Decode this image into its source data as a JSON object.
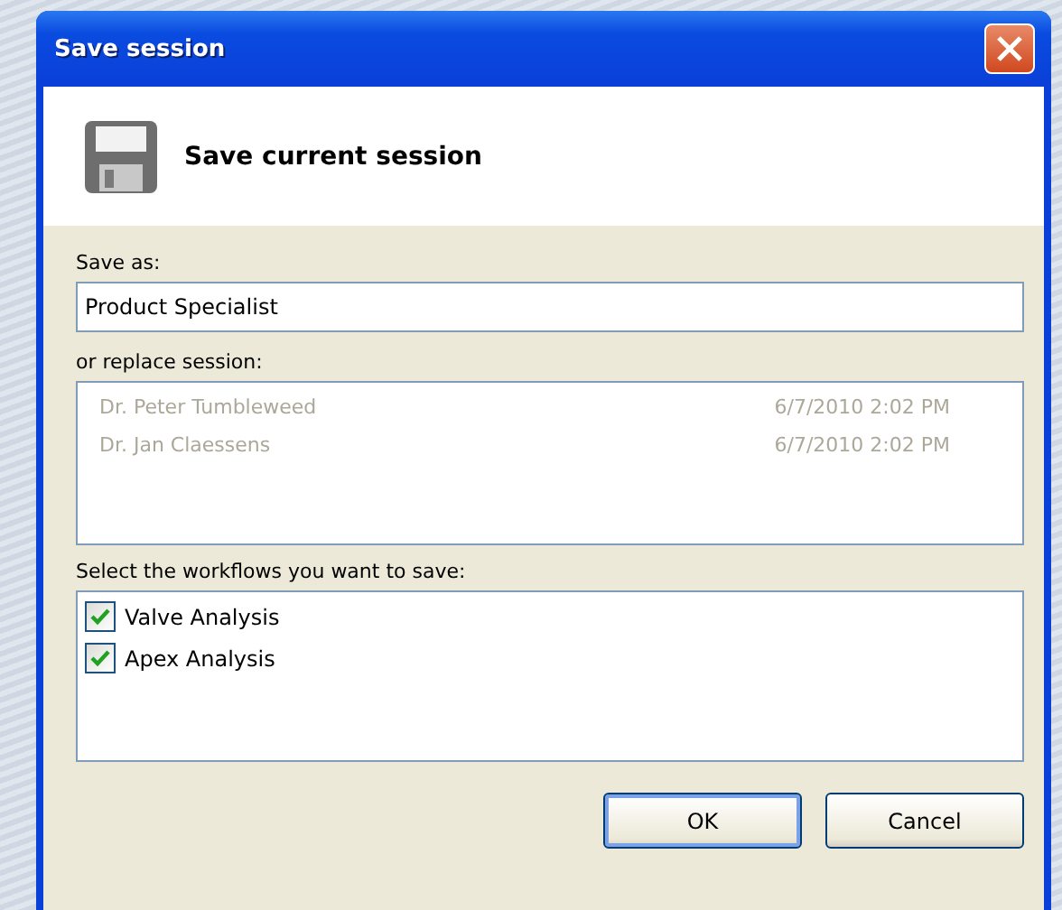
{
  "window": {
    "title": "Save session"
  },
  "header": {
    "title": "Save current session"
  },
  "save_as": {
    "label": "Save as:",
    "value": "Product Specialist"
  },
  "replace": {
    "label": "or replace session:",
    "disabled": true,
    "sessions": [
      {
        "name": "Dr. Peter Tumbleweed",
        "date": "6/7/2010 2:02 PM"
      },
      {
        "name": "Dr. Jan Claessens",
        "date": "6/7/2010 2:02 PM"
      }
    ]
  },
  "workflows": {
    "label": "Select the workflows you want to save:",
    "items": [
      {
        "label": "Valve Analysis",
        "checked": true
      },
      {
        "label": "Apex Analysis",
        "checked": true
      }
    ]
  },
  "buttons": [
    {
      "label": "OK",
      "default": true
    },
    {
      "label": "Cancel",
      "default": false
    }
  ]
}
